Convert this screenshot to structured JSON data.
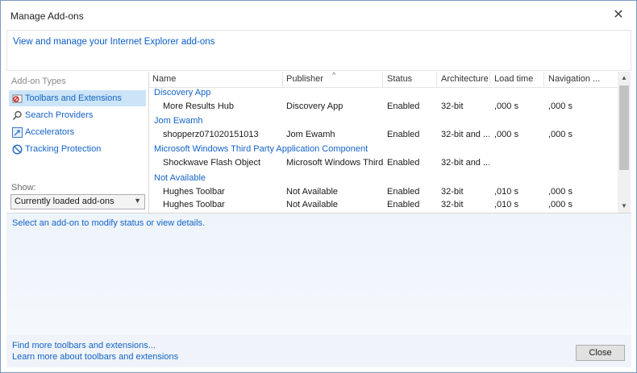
{
  "window": {
    "title": "Manage Add-ons",
    "close_glyph": "✕"
  },
  "banner": {
    "link": "View and manage your Internet Explorer add-ons"
  },
  "sidebar": {
    "heading": "Add-on Types",
    "items": [
      {
        "label": "Toolbars and Extensions",
        "icon": "toolbars-extensions-icon",
        "selected": true
      },
      {
        "label": "Search Providers",
        "icon": "search-icon",
        "selected": false
      },
      {
        "label": "Accelerators",
        "icon": "accelerators-icon",
        "selected": false
      },
      {
        "label": "Tracking Protection",
        "icon": "tracking-protection-icon",
        "selected": false
      }
    ],
    "show_label": "Show:",
    "show_value": "Currently loaded add-ons"
  },
  "table": {
    "columns": [
      "Name",
      "Publisher",
      "Status",
      "Architecture",
      "Load time",
      "Navigation ..."
    ],
    "groups": [
      {
        "name": "Discovery App",
        "rows": [
          {
            "name": "More Results Hub",
            "publisher": "Discovery App",
            "status": "Enabled",
            "architecture": "32-bit",
            "load_time": ",000 s",
            "navigation": ",000 s"
          }
        ]
      },
      {
        "name": "Jom Ewamh",
        "rows": [
          {
            "name": "shopperz071020151013",
            "publisher": "Jom Ewamh",
            "status": "Enabled",
            "architecture": "32-bit and ...",
            "load_time": ",000 s",
            "navigation": ",000 s"
          }
        ]
      },
      {
        "name": "Microsoft Windows Third Party Application Component",
        "rows": [
          {
            "name": "Shockwave Flash Object",
            "publisher": "Microsoft Windows Third...",
            "status": "Enabled",
            "architecture": "32-bit and ...",
            "load_time": "",
            "navigation": ""
          }
        ]
      },
      {
        "name": "Not Available",
        "rows": [
          {
            "name": "Hughes Toolbar",
            "publisher": "Not Available",
            "status": "Enabled",
            "architecture": "32-bit",
            "load_time": ",010 s",
            "navigation": ",000 s"
          },
          {
            "name": "Hughes Toolbar",
            "publisher": "Not Available",
            "status": "Enabled",
            "architecture": "32-bit",
            "load_time": ",010 s",
            "navigation": ",000 s"
          }
        ]
      }
    ]
  },
  "details": {
    "status_text": "Select an add-on to modify status or view details."
  },
  "footer": {
    "link1": "Find more toolbars and extensions...",
    "link2": "Learn more about toolbars and extensions",
    "close_label": "Close"
  },
  "colors": {
    "link": "#1463c7",
    "selection": "#cce4f7"
  }
}
